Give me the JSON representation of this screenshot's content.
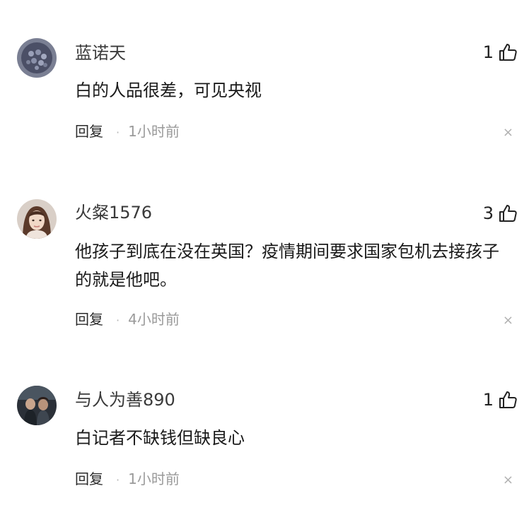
{
  "comments": [
    {
      "username": "蓝诺天",
      "text": "白的人品很差，可见央视",
      "likes": "1",
      "reply_label": "回复",
      "separator": "·",
      "time": "1小时前",
      "close_glyph": "×",
      "avatar_icon": "avatar-icon"
    },
    {
      "username": "火粲1576",
      "text": "他孩子到底在没在英国？疫情期间要求国家包机去接孩子的就是他吧。",
      "likes": "3",
      "reply_label": "回复",
      "separator": "·",
      "time": "4小时前",
      "close_glyph": "×",
      "avatar_icon": "avatar-icon"
    },
    {
      "username": "与人为善890",
      "text": "白记者不缺钱但缺良心",
      "likes": "1",
      "reply_label": "回复",
      "separator": "·",
      "time": "1小时前",
      "close_glyph": "×",
      "avatar_icon": "avatar-icon"
    }
  ],
  "like_icon": "thumbs-up-icon",
  "colors": {
    "text": "#1a1a1a",
    "meta": "#9a9a9a",
    "background": "#ffffff"
  }
}
